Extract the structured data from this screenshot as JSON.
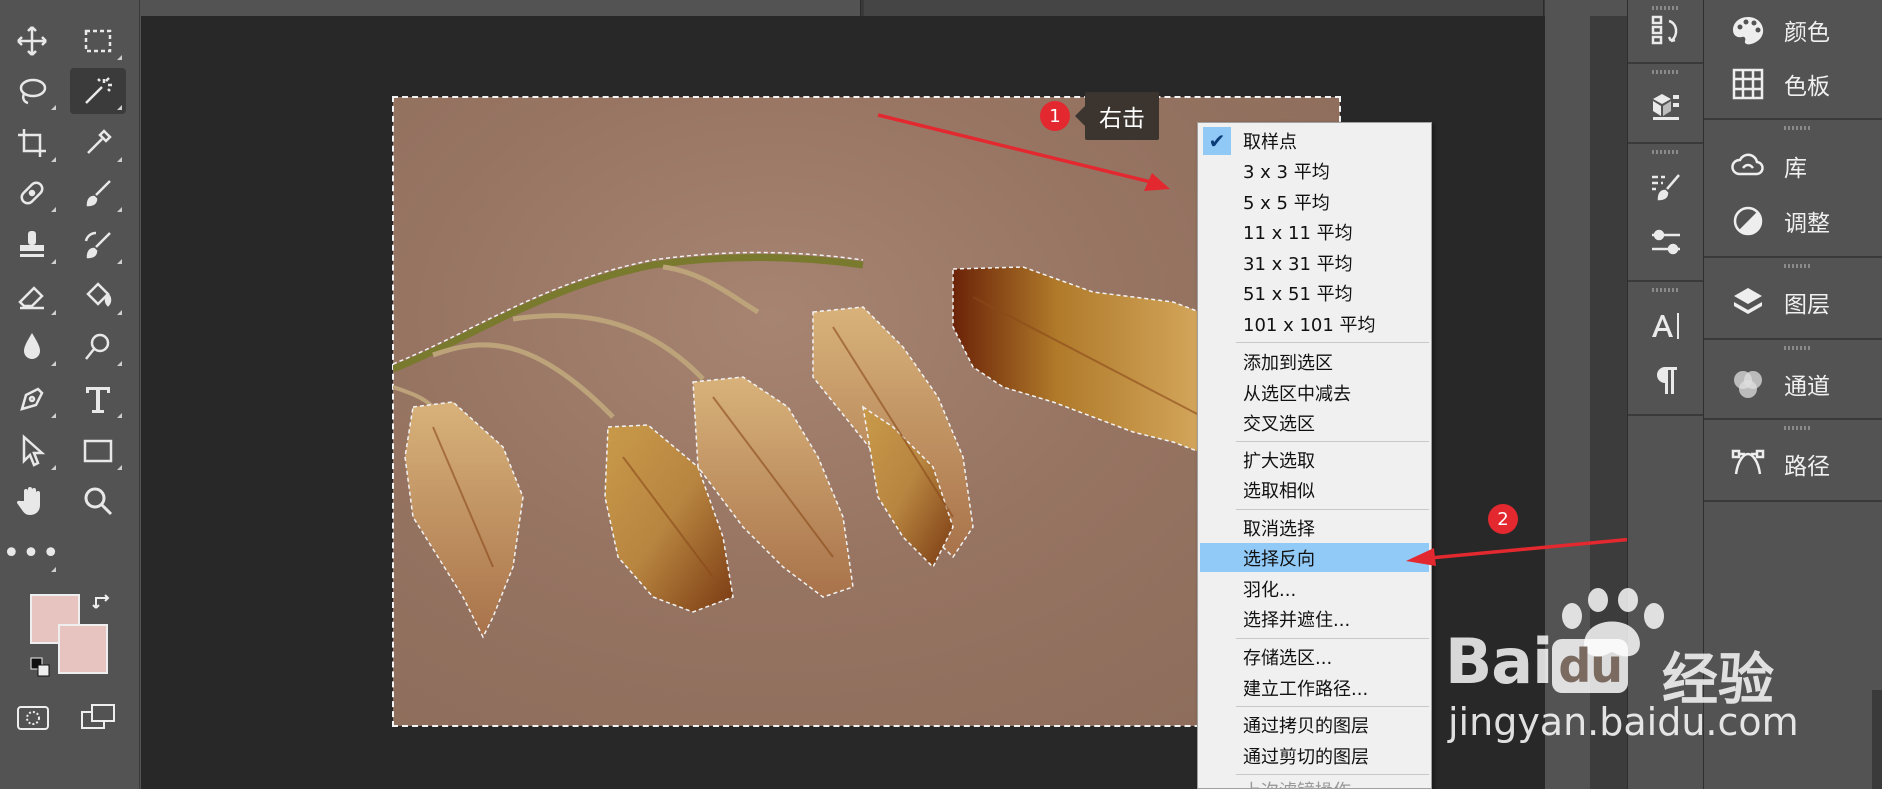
{
  "toolbar": {
    "tools": [
      {
        "name": "move-tool"
      },
      {
        "name": "rect-marquee-tool"
      },
      {
        "name": "lasso-tool"
      },
      {
        "name": "magic-wand-tool",
        "active": true
      },
      {
        "name": "crop-tool"
      },
      {
        "name": "eyedropper-tool"
      },
      {
        "name": "spot-healing-tool"
      },
      {
        "name": "brush-tool"
      },
      {
        "name": "stamp-tool"
      },
      {
        "name": "history-brush-tool"
      },
      {
        "name": "eraser-tool"
      },
      {
        "name": "paint-bucket-tool"
      },
      {
        "name": "blur-tool"
      },
      {
        "name": "dodge-tool"
      },
      {
        "name": "pen-tool"
      },
      {
        "name": "type-tool"
      },
      {
        "name": "path-selection-tool"
      },
      {
        "name": "rectangle-tool"
      },
      {
        "name": "hand-tool"
      },
      {
        "name": "zoom-tool"
      }
    ],
    "more": "•••",
    "foreground_color": "#e7c4bf",
    "background_color": "#e7c4bf"
  },
  "annotations": {
    "step1_badge": "1",
    "step1_tip": "右击",
    "step2_badge": "2",
    "arrow_color": "#e3282f"
  },
  "context_menu": {
    "items": [
      {
        "label": "取样点",
        "checked": true
      },
      {
        "label": "3 x 3 平均"
      },
      {
        "label": "5 x 5 平均"
      },
      {
        "label": "11 x 11 平均"
      },
      {
        "label": "31 x 31 平均"
      },
      {
        "label": "51 x 51 平均"
      },
      {
        "label": "101 x 101 平均"
      },
      {
        "label": "添加到选区"
      },
      {
        "label": "从选区中减去"
      },
      {
        "label": "交叉选区"
      },
      {
        "label": "扩大选取"
      },
      {
        "label": "选取相似"
      },
      {
        "label": "取消选择"
      },
      {
        "label": "选择反向",
        "highlighted": true
      },
      {
        "label": "羽化..."
      },
      {
        "label": "选择并遮住..."
      },
      {
        "label": "存储选区..."
      },
      {
        "label": "建立工作路径..."
      },
      {
        "label": "通过拷贝的图层"
      },
      {
        "label": "通过剪切的图层"
      },
      {
        "label": "上次滤镜操作"
      }
    ]
  },
  "panel_strip": {
    "icons": [
      "history-icon",
      "3d-icon",
      "brush-settings-icon",
      "properties-icon",
      "character-icon",
      "paragraph-icon"
    ]
  },
  "panels": [
    {
      "label": "颜色",
      "icon": "palette-icon"
    },
    {
      "label": "色板",
      "icon": "swatches-icon"
    },
    {
      "label": "库",
      "icon": "libraries-icon"
    },
    {
      "label": "调整",
      "icon": "adjustments-icon"
    },
    {
      "label": "图层",
      "icon": "layers-icon"
    },
    {
      "label": "通道",
      "icon": "channels-icon"
    },
    {
      "label": "路径",
      "icon": "paths-icon"
    }
  ],
  "watermark": {
    "logo_bai": "Bai",
    "logo_du": "du",
    "logo_cn": "经验",
    "url": "jingyan.baidu.com"
  }
}
